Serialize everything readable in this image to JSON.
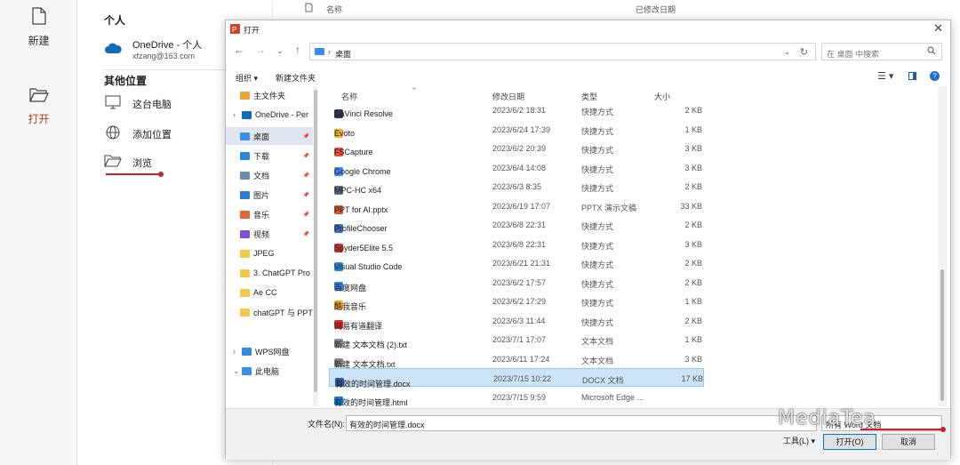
{
  "left_nav": {
    "new_label": "新建",
    "open_label": "打开"
  },
  "places": {
    "personal_header": "个人",
    "onedrive_name": "OneDrive - 个人",
    "onedrive_email": "xfzang@163.com",
    "other_header": "其他位置",
    "this_pc": "这台电脑",
    "add_place": "添加位置",
    "browse": "浏览"
  },
  "background_list": {
    "col_name": "名称",
    "col_modified": "已修改日期"
  },
  "dialog": {
    "title": "打开",
    "breadcrumb": "桌面",
    "search_placeholder": "在 桌面 中搜索",
    "organize": "组织 ▾",
    "new_folder": "新建文件夹",
    "tree": [
      {
        "label": "主文件夹",
        "icon": "home-icon",
        "color": "#e8a33d"
      },
      {
        "label": "OneDrive - Per",
        "icon": "cloud-icon",
        "color": "#0f6cbd"
      },
      {
        "label": "桌面",
        "icon": "desktop-icon",
        "color": "#3a8ee6",
        "pinned": true,
        "selected": true
      },
      {
        "label": "下载",
        "icon": "download-icon",
        "color": "#2b88d8",
        "pinned": true
      },
      {
        "label": "文档",
        "icon": "document-icon",
        "color": "#6b8cae",
        "pinned": true
      },
      {
        "label": "图片",
        "icon": "picture-icon",
        "color": "#2b7cd3",
        "pinned": true
      },
      {
        "label": "音乐",
        "icon": "music-icon",
        "color": "#e0653a",
        "pinned": true
      },
      {
        "label": "视频",
        "icon": "video-icon",
        "color": "#7b4fd6",
        "pinned": true
      },
      {
        "label": "JPEG",
        "icon": "folder-icon",
        "color": "#f2c94c"
      },
      {
        "label": "3. ChatGPT Pro",
        "icon": "folder-icon",
        "color": "#f2c94c"
      },
      {
        "label": "Ae CC",
        "icon": "folder-icon",
        "color": "#f2c94c"
      },
      {
        "label": "chatGPT 与 PPT",
        "icon": "folder-icon",
        "color": "#f2c94c"
      },
      {
        "label": "WPS网盘",
        "icon": "cloud-drive-icon",
        "color": "#2f8ae0"
      },
      {
        "label": "此电脑",
        "icon": "computer-icon",
        "color": "#3a8ee6"
      }
    ],
    "columns": {
      "name": "名称",
      "modified": "修改日期",
      "type": "类型",
      "size": "大小"
    },
    "files": [
      {
        "name": "DaVinci Resolve",
        "date": "2023/6/2 18:31",
        "type": "快捷方式",
        "size": "2 KB",
        "icon": "davinci-icon",
        "color": "#2a3b5a"
      },
      {
        "name": "Evoto",
        "date": "2023/6/24 17:39",
        "type": "快捷方式",
        "size": "1 KB",
        "icon": "evoto-icon",
        "color": "#f2b233"
      },
      {
        "name": "FSCapture",
        "date": "2023/6/2 20:39",
        "type": "快捷方式",
        "size": "3 KB",
        "icon": "fscapture-icon",
        "color": "#e84c3d"
      },
      {
        "name": "Google Chrome",
        "date": "2023/6/4 14:08",
        "type": "快捷方式",
        "size": "3 KB",
        "icon": "chrome-icon",
        "color": "#4285f4"
      },
      {
        "name": "MPC-HC x64",
        "date": "2023/6/3 8:35",
        "type": "快捷方式",
        "size": "2 KB",
        "icon": "mpc-icon",
        "color": "#5a6b7c"
      },
      {
        "name": "PPT for AI.pptx",
        "date": "2023/6/19 17:07",
        "type": "PPTX 演示文稿",
        "size": "33 KB",
        "icon": "pptx-icon",
        "color": "#d35230"
      },
      {
        "name": "ProfileChooser",
        "date": "2023/6/8 22:31",
        "type": "快捷方式",
        "size": "2 KB",
        "icon": "profile-icon",
        "color": "#3b6fb6"
      },
      {
        "name": "Spyder5Elite 5.5",
        "date": "2023/6/8 22:31",
        "type": "快捷方式",
        "size": "3 KB",
        "icon": "spyder-icon",
        "color": "#c0392b"
      },
      {
        "name": "Visual Studio Code",
        "date": "2023/6/21 21:31",
        "type": "快捷方式",
        "size": "2 KB",
        "icon": "vscode-icon",
        "color": "#1f8ad2"
      },
      {
        "name": "百度网盘",
        "date": "2023/6/2 17:57",
        "type": "快捷方式",
        "size": "2 KB",
        "icon": "baidu-icon",
        "color": "#2e7fe6"
      },
      {
        "name": "酷我音乐",
        "date": "2023/6/2 17:29",
        "type": "快捷方式",
        "size": "1 KB",
        "icon": "kuwo-icon",
        "color": "#f5a623"
      },
      {
        "name": "网易有道翻译",
        "date": "2023/6/3 11:44",
        "type": "快捷方式",
        "size": "2 KB",
        "icon": "youdao-icon",
        "color": "#e02a2a"
      },
      {
        "name": "新建 文本文档 (2).txt",
        "date": "2023/7/1 17:07",
        "type": "文本文档",
        "size": "1 KB",
        "icon": "txt-icon",
        "color": "#8a8a8a"
      },
      {
        "name": "新建 文本文档.txt",
        "date": "2023/6/11 17:24",
        "type": "文本文档",
        "size": "3 KB",
        "icon": "txt-icon",
        "color": "#8a8a8a"
      },
      {
        "name": "有效的时间管理.docx",
        "date": "2023/7/15 10:22",
        "type": "DOCX 文档",
        "size": "17 KB",
        "icon": "docx-icon",
        "color": "#2b579a",
        "selected": true
      },
      {
        "name": "有效的时间管理.html",
        "date": "2023/7/15 9:59",
        "type": "Microsoft Edge ...",
        "size": "",
        "icon": "edge-icon",
        "color": "#0c7cd5"
      }
    ],
    "filename_label": "文件名(N):",
    "filename_value": "有效的时间管理.docx",
    "filetype_value": "所有 Word 文档",
    "tools_label": "工具(L) ▾",
    "open_button": "打开(O)",
    "cancel_button": "取消"
  },
  "watermark": "MediaTea",
  "accent_color": "#c8232c"
}
